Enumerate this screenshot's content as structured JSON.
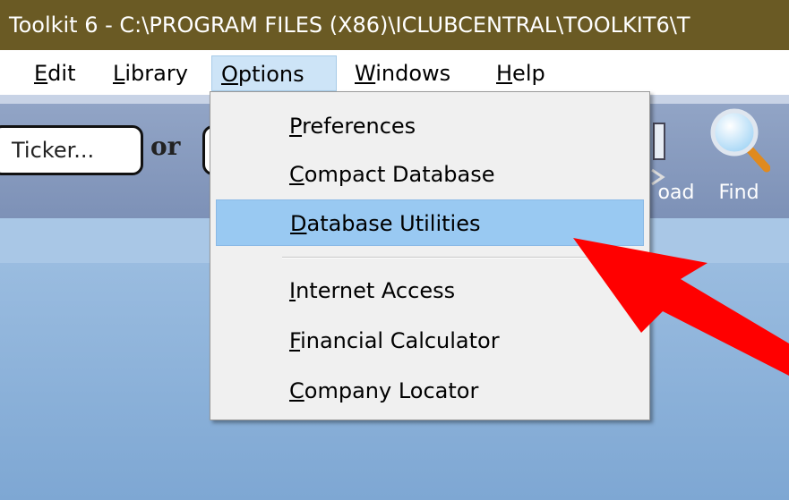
{
  "window": {
    "title": "Toolkit 6 - C:\\PROGRAM FILES (X86)\\ICLUBCENTRAL\\TOOLKIT6\\T"
  },
  "menubar": {
    "items": [
      {
        "label_first": "E",
        "label_rest": "dit"
      },
      {
        "label_first": "L",
        "label_rest": "ibrary"
      },
      {
        "label_first": "O",
        "label_rest": "ptions"
      },
      {
        "label_first": "W",
        "label_rest": "indows"
      },
      {
        "label_first": "H",
        "label_rest": "elp"
      }
    ]
  },
  "toolbar": {
    "ticker_placeholder": "Ticker...",
    "or_text": "or",
    "download_label": "oad",
    "find_label": "Find"
  },
  "options_menu": {
    "items": [
      {
        "first": "P",
        "rest": "references"
      },
      {
        "first": "C",
        "rest": "ompact Database"
      },
      {
        "first": "D",
        "rest": "atabase Utilities"
      },
      {
        "first": "I",
        "rest": "nternet Access"
      },
      {
        "first": "F",
        "rest": "inancial Calculator"
      },
      {
        "first": "C",
        "rest": "ompany Locator"
      }
    ],
    "highlighted_index": 2
  },
  "colors": {
    "titlebar": "#6a5a24",
    "highlight": "#99c9f2",
    "arrow": "#ff0000"
  },
  "icons": [
    "download-icon",
    "magnifier-icon",
    "red-arrow-icon"
  ]
}
